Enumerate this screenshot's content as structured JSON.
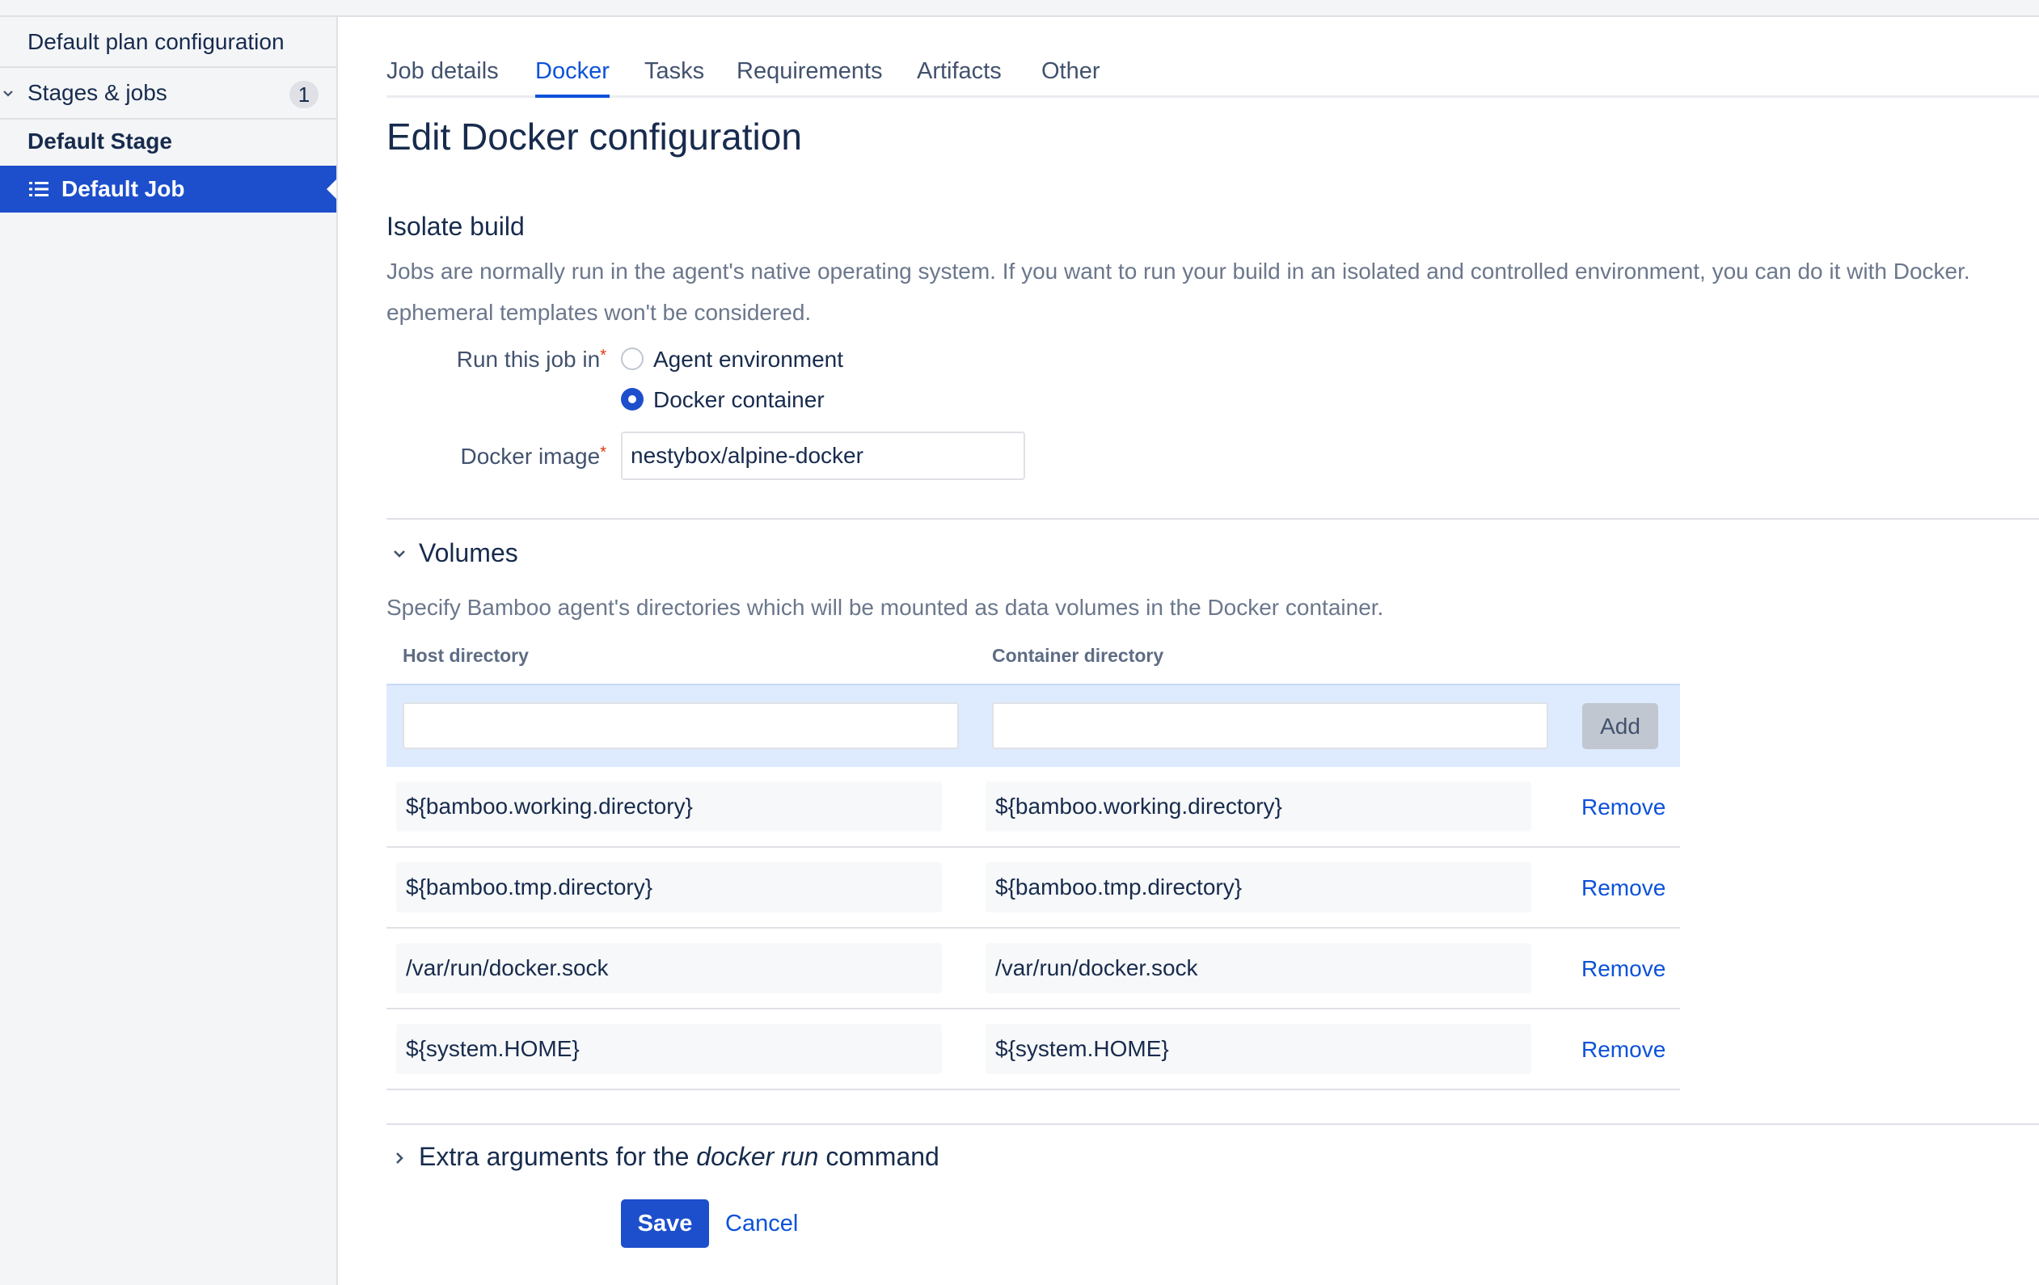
{
  "sidebar": {
    "plan_config": "Default plan configuration",
    "stages_jobs": "Stages & jobs",
    "stages_count": "1",
    "stage": "Default Stage",
    "job": "Default Job"
  },
  "tabs": [
    "Job details",
    "Docker",
    "Tasks",
    "Requirements",
    "Artifacts",
    "Other"
  ],
  "active_tab": "Docker",
  "page_title": "Edit Docker configuration",
  "isolate": {
    "heading": "Isolate build",
    "desc_line1": "Jobs are normally run in the agent's native operating system. If you want to run your build in an isolated and controlled environment, you can do it with Docker.",
    "desc_line2": "ephemeral templates won't be considered.",
    "run_label": "Run this job in",
    "required_mark": "*",
    "option_agent": "Agent environment",
    "option_docker": "Docker container",
    "selected_option": "Docker container",
    "image_label": "Docker image",
    "image_value": "nestybox/alpine-docker"
  },
  "volumes": {
    "heading": "Volumes",
    "desc": "Specify Bamboo agent's directories which will be mounted as data volumes in the Docker container.",
    "col_host": "Host directory",
    "col_container": "Container directory",
    "new_host_value": "",
    "new_container_value": "",
    "add_label": "Add",
    "remove_label": "Remove",
    "rows": [
      {
        "host": "${bamboo.working.directory}",
        "container": "${bamboo.working.directory}"
      },
      {
        "host": "${bamboo.tmp.directory}",
        "container": "${bamboo.tmp.directory}"
      },
      {
        "host": "/var/run/docker.sock",
        "container": "/var/run/docker.sock"
      },
      {
        "host": "${system.HOME}",
        "container": "${system.HOME}"
      }
    ]
  },
  "extra_args": {
    "prefix": "Extra arguments for the ",
    "emphasis": "docker run",
    "suffix": " command"
  },
  "actions": {
    "save": "Save",
    "cancel": "Cancel"
  },
  "colors": {
    "primary": "#1d4fcc",
    "link": "#0c52d9",
    "required": "#de350b"
  }
}
